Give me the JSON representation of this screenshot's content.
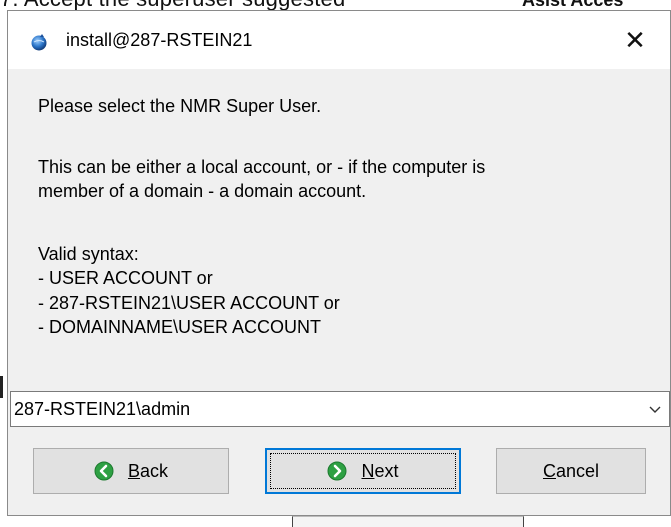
{
  "background": {
    "top_left_text": "7.  Accept the superuser suggested",
    "top_right_text": "Asist Acces"
  },
  "window": {
    "title": "install@287-RSTEIN21",
    "close_label": "✕"
  },
  "message": {
    "line1": "Please select the NMR Super User.",
    "line2": " This can be either a local account, or  - if the computer is",
    "line3": "member of a domain -  a domain account.",
    "line4": "Valid syntax:",
    "line5": "- USER ACCOUNT  or",
    "line6": "- 287-RSTEIN21\\USER ACCOUNT  or",
    "line7": "- DOMAINNAME\\USER ACCOUNT"
  },
  "combo": {
    "value": "287-RSTEIN21\\admin"
  },
  "buttons": {
    "back": {
      "mnemonic": "B",
      "rest": "ack"
    },
    "next": {
      "mnemonic": "N",
      "rest": "ext"
    },
    "cancel": {
      "mnemonic": "C",
      "rest": "ancel"
    }
  },
  "colors": {
    "dialog_bg": "#f0f0f0",
    "button_bg": "#e1e1e1",
    "focus_border": "#0078d7",
    "nav_icon_green": "#2ea043"
  },
  "icons": {
    "title": "app-globe-icon",
    "back": "arrow-left-circle-icon",
    "next": "arrow-right-circle-icon",
    "combo": "chevron-down-icon"
  }
}
